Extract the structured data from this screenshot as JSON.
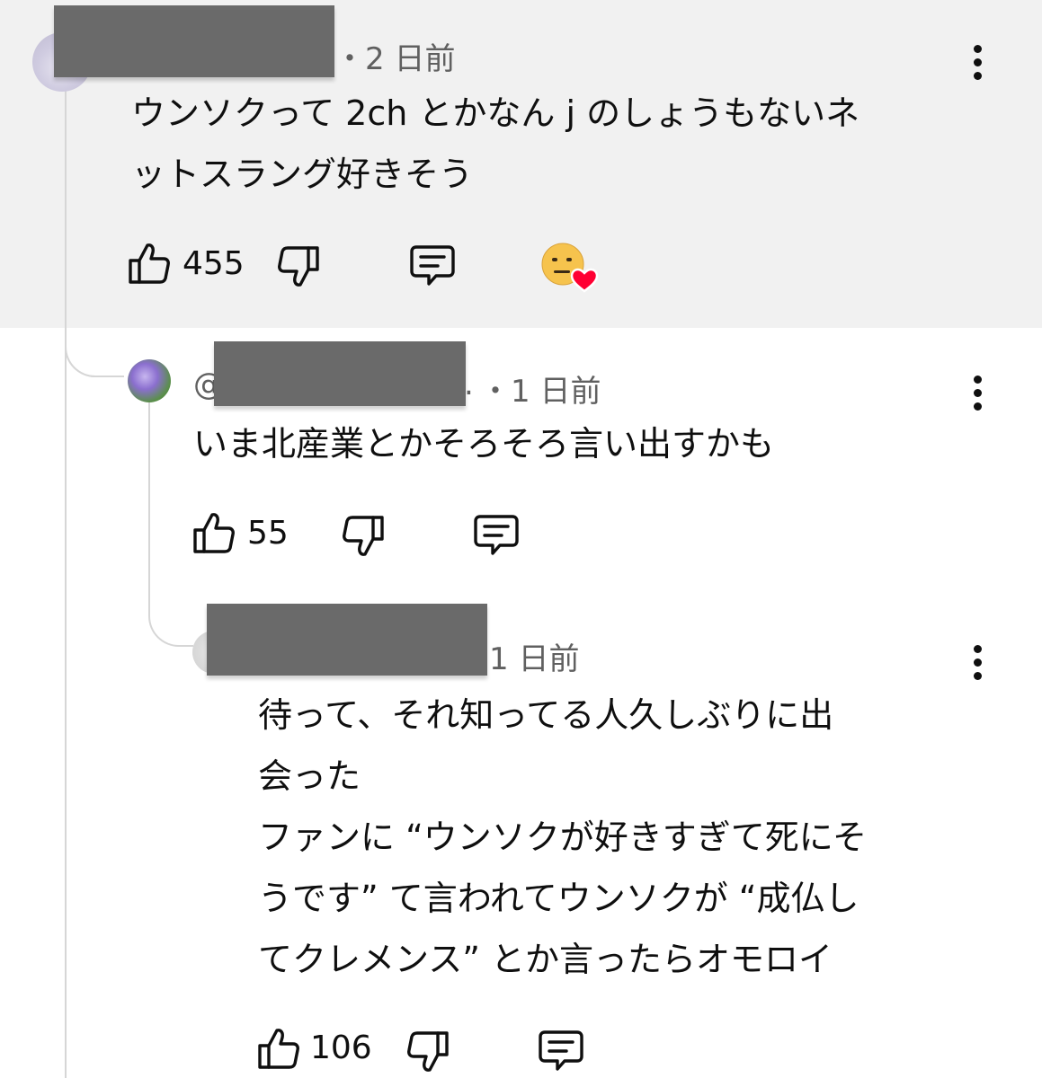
{
  "comments": [
    {
      "time": "・2 日前",
      "text_lines": [
        "ウンソクって 2ch とかなん j のしょうもないネ",
        "ットスラング好きそう"
      ],
      "likes": "455",
      "reaction": "creator-heart"
    },
    {
      "handle_prefix": "@",
      "handle_suffix": ".",
      "time": "・1 日前",
      "text_lines": [
        "いま北産業とかそろそろ言い出すかも"
      ],
      "likes": "55"
    },
    {
      "time": "1 日前",
      "text_lines": [
        "待って、それ知ってる人久しぶりに出",
        "会った",
        "ファンに “ウンソクが好きすぎて死にそ",
        "うです” て言われてウンソクが “成仏し",
        "てクレメンス” とか言ったらオモロイ"
      ],
      "likes": "106"
    }
  ],
  "colors": {
    "highlight_bg": "#f1f1f1",
    "text": "#0f0f0f",
    "meta": "#606060",
    "thread_line": "#d6d6d6",
    "redaction": "#6a6a6a",
    "heart": "#ff0033"
  },
  "icons": [
    "thumb-up-icon",
    "thumb-down-icon",
    "reply-icon",
    "more-vert-icon",
    "creator-heart-icon"
  ]
}
